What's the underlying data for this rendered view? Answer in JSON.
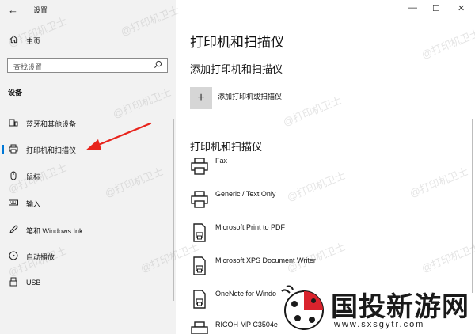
{
  "window": {
    "title": "设置",
    "back_glyph": "←",
    "minimize_glyph": "—",
    "maximize_glyph": "☐",
    "close_glyph": "✕"
  },
  "sidebar": {
    "home_label": "主页",
    "search_placeholder": "查找设置",
    "section_label": "设备",
    "items": [
      {
        "label": "蓝牙和其他设备",
        "icon": "bluetooth-devices-icon"
      },
      {
        "label": "打印机和扫描仪",
        "icon": "printer-icon",
        "active": true
      },
      {
        "label": "鼠标",
        "icon": "mouse-icon"
      },
      {
        "label": "输入",
        "icon": "keyboard-icon"
      },
      {
        "label": "笔和 Windows Ink",
        "icon": "pen-icon"
      },
      {
        "label": "自动播放",
        "icon": "autoplay-icon"
      },
      {
        "label": "USB",
        "icon": "usb-icon"
      }
    ]
  },
  "main": {
    "title": "打印机和扫描仪",
    "add_section_title": "添加打印机和扫描仪",
    "add_button_label": "添加打印机或扫描仪",
    "add_button_glyph": "+",
    "list_section_title": "打印机和扫描仪",
    "printers": [
      {
        "name": "Fax",
        "icon": "printer-icon"
      },
      {
        "name": "Generic / Text Only",
        "icon": "printer-icon"
      },
      {
        "name": "Microsoft Print to PDF",
        "icon": "document-printer-icon"
      },
      {
        "name": "Microsoft XPS Document Writer",
        "icon": "document-printer-icon"
      },
      {
        "name": "OneNote for Windo",
        "icon": "document-printer-icon"
      },
      {
        "name": "RICOH MP C3504e",
        "icon": "printer-icon"
      }
    ]
  },
  "watermark_text": "@打印机卫士",
  "brand": {
    "name": "国投新游网",
    "url": "www.sxsgytr.com"
  },
  "colors": {
    "accent": "#0078d7",
    "arrow": "#e8231b",
    "sidebar_bg": "#f2f2f2"
  }
}
